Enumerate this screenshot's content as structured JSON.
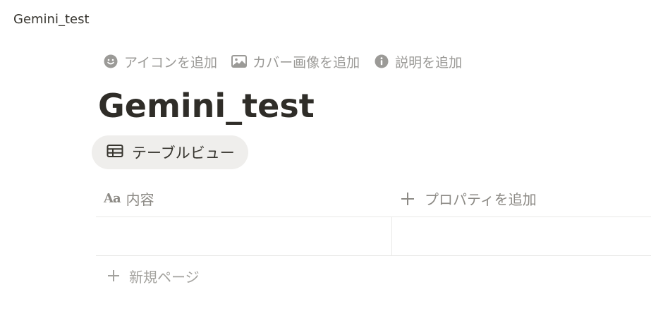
{
  "window": {
    "breadcrumb": "Gemini_test"
  },
  "page_actions": [
    {
      "icon": "smiley-icon",
      "label": "アイコンを追加"
    },
    {
      "icon": "image-icon",
      "label": "カバー画像を追加"
    },
    {
      "icon": "info-icon",
      "label": "説明を追加"
    }
  ],
  "page": {
    "title": "Gemini_test"
  },
  "view": {
    "icon": "table-icon",
    "label": "テーブルビュー"
  },
  "table": {
    "columns": [
      {
        "icon": "text-property-icon",
        "icon_text": "Aa",
        "label": "内容"
      }
    ],
    "add_property": {
      "icon": "plus-icon",
      "label": "プロパティを追加"
    },
    "rows": [
      {
        "name": ""
      }
    ],
    "new_page": {
      "icon": "plus-icon",
      "label": "新規ページ"
    }
  },
  "colors": {
    "text": "#37352f",
    "muted": "#9b9a97",
    "pill_bg": "#efeeec",
    "divider": "#e9e9e7"
  }
}
